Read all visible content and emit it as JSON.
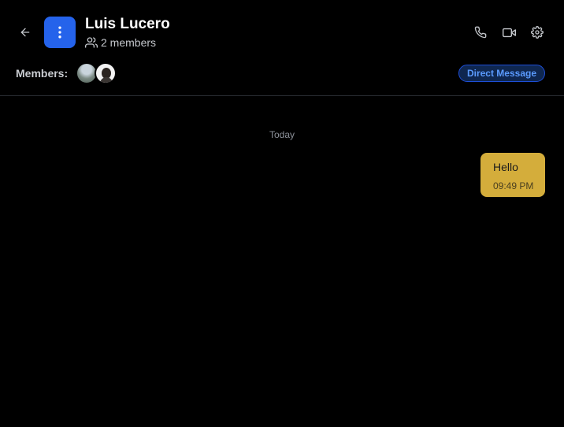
{
  "chat": {
    "title": "Luis Lucero",
    "member_count_text": "2 members",
    "members_label": "Members:",
    "badge": "Direct Message"
  },
  "icons": {
    "back": "arrow-left-icon",
    "menu": "more-vertical-icon",
    "members": "users-icon",
    "call": "phone-icon",
    "video": "video-icon",
    "settings": "gear-icon"
  },
  "colors": {
    "background": "#000000",
    "accent": "#2563eb",
    "bubble": "#d4ad3b",
    "badge_text": "#5b9bff"
  },
  "messages": {
    "day_label": "Today",
    "items": [
      {
        "text": "Hello",
        "time": "09:49 PM",
        "outgoing": true
      }
    ]
  }
}
